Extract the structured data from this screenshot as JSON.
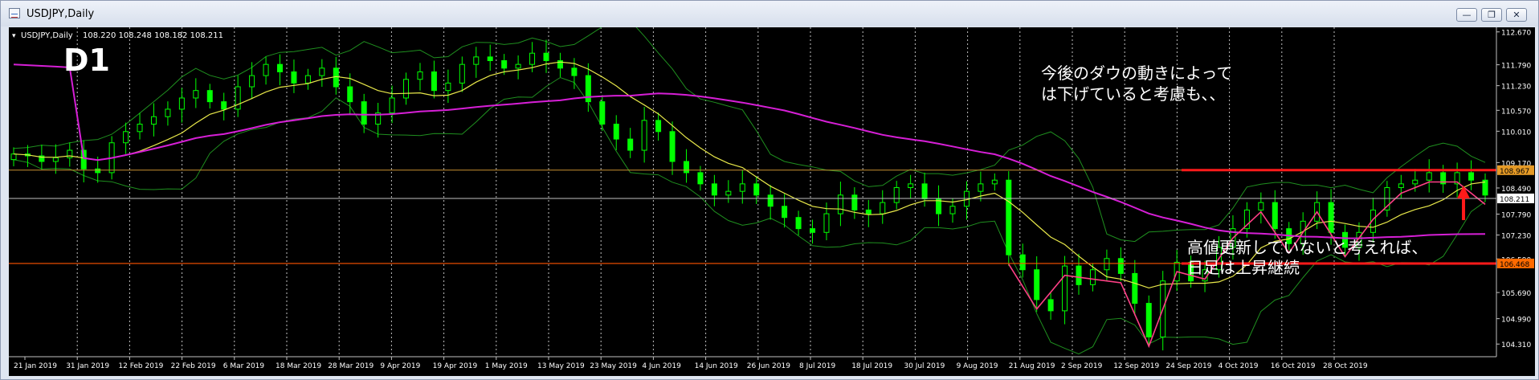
{
  "window": {
    "title": "USDJPY,Daily",
    "min_label": "—",
    "restore_label": "❐",
    "close_label": "✕"
  },
  "chart_header": {
    "symbol": "USDJPY,Daily",
    "ohlc": "108.220 108.248 108.182 108.211",
    "timeframe_badge": "D1"
  },
  "annotations": {
    "upper_note": [
      "今後のダウの動きによって",
      "は下げていると考慮も、、"
    ],
    "lower_note": [
      "高値更新していないと考えれば、",
      "日足は上昇継続"
    ]
  },
  "colors": {
    "background": "#000000",
    "bull": "#00ff00",
    "bear": "#00ff00",
    "ma_fast": "#e8e84a",
    "ma_slow": "#d61fd6",
    "bands": "#1f8f1f",
    "zigzag": "#ff3f86",
    "resistance": "#ff1a1a",
    "support": "#ff5500",
    "price_line": "#c0c0c0",
    "orange_line": "#c89030"
  },
  "chart_data": {
    "type": "candlestick",
    "symbol": "USDJPY",
    "timeframe": "Daily",
    "ylim": [
      104.1,
      112.75
    ],
    "y_ticks": [
      "112.670",
      "111.790",
      "111.230",
      "110.570",
      "110.010",
      "109.170",
      "108.490",
      "107.790",
      "107.230",
      "106.590",
      "105.690",
      "104.990",
      "104.310"
    ],
    "x_ticks": [
      "21 Jan 2019",
      "31 Jan 2019",
      "12 Feb 2019",
      "22 Feb 2019",
      "6 Mar 2019",
      "18 Mar 2019",
      "28 Mar 2019",
      "9 Apr 2019",
      "19 Apr 2019",
      "1 May 2019",
      "13 May 2019",
      "23 May 2019",
      "4 Jun 2019",
      "14 Jun 2019",
      "26 Jun 2019",
      "8 Jul 2019",
      "18 Jul 2019",
      "30 Jul 2019",
      "9 Aug 2019",
      "21 Aug 2019",
      "2 Sep 2019",
      "12 Sep 2019",
      "24 Sep 2019",
      "4 Oct 2019",
      "16 Oct 2019",
      "28 Oct 2019"
    ],
    "price_close_series": [
      109.4,
      109.35,
      109.2,
      109.3,
      109.5,
      109.0,
      108.9,
      109.7,
      110.0,
      110.2,
      110.4,
      110.6,
      110.9,
      111.1,
      110.8,
      110.6,
      111.2,
      111.5,
      111.8,
      111.6,
      111.3,
      111.5,
      111.7,
      111.2,
      110.8,
      110.2,
      110.5,
      110.9,
      111.4,
      111.6,
      111.1,
      111.3,
      111.8,
      112.0,
      111.9,
      111.7,
      111.8,
      112.1,
      111.9,
      111.7,
      111.5,
      110.8,
      110.2,
      109.8,
      109.5,
      110.3,
      110.0,
      109.2,
      108.9,
      108.6,
      108.3,
      108.4,
      108.6,
      108.3,
      108.0,
      107.7,
      107.4,
      107.3,
      107.8,
      108.3,
      107.9,
      107.8,
      108.1,
      108.5,
      108.6,
      108.2,
      107.8,
      108.0,
      108.4,
      108.6,
      108.7,
      106.7,
      106.3,
      105.5,
      105.2,
      106.4,
      105.9,
      106.3,
      106.6,
      106.2,
      105.4,
      104.5,
      106.0,
      106.5,
      106.0,
      106.3,
      106.9,
      107.4,
      107.9,
      108.1,
      107.4,
      107.0,
      107.6,
      108.1,
      107.3,
      106.9,
      107.3,
      107.9,
      108.5,
      108.6,
      108.7,
      108.9,
      108.6,
      108.9,
      108.7,
      108.3
    ],
    "horizontal_levels": {
      "resistance": "108.967",
      "current": "108.211",
      "support": "106.468"
    },
    "indicators": [
      "moving average fast",
      "moving average slow",
      "bollinger bands",
      "zigzag"
    ]
  }
}
